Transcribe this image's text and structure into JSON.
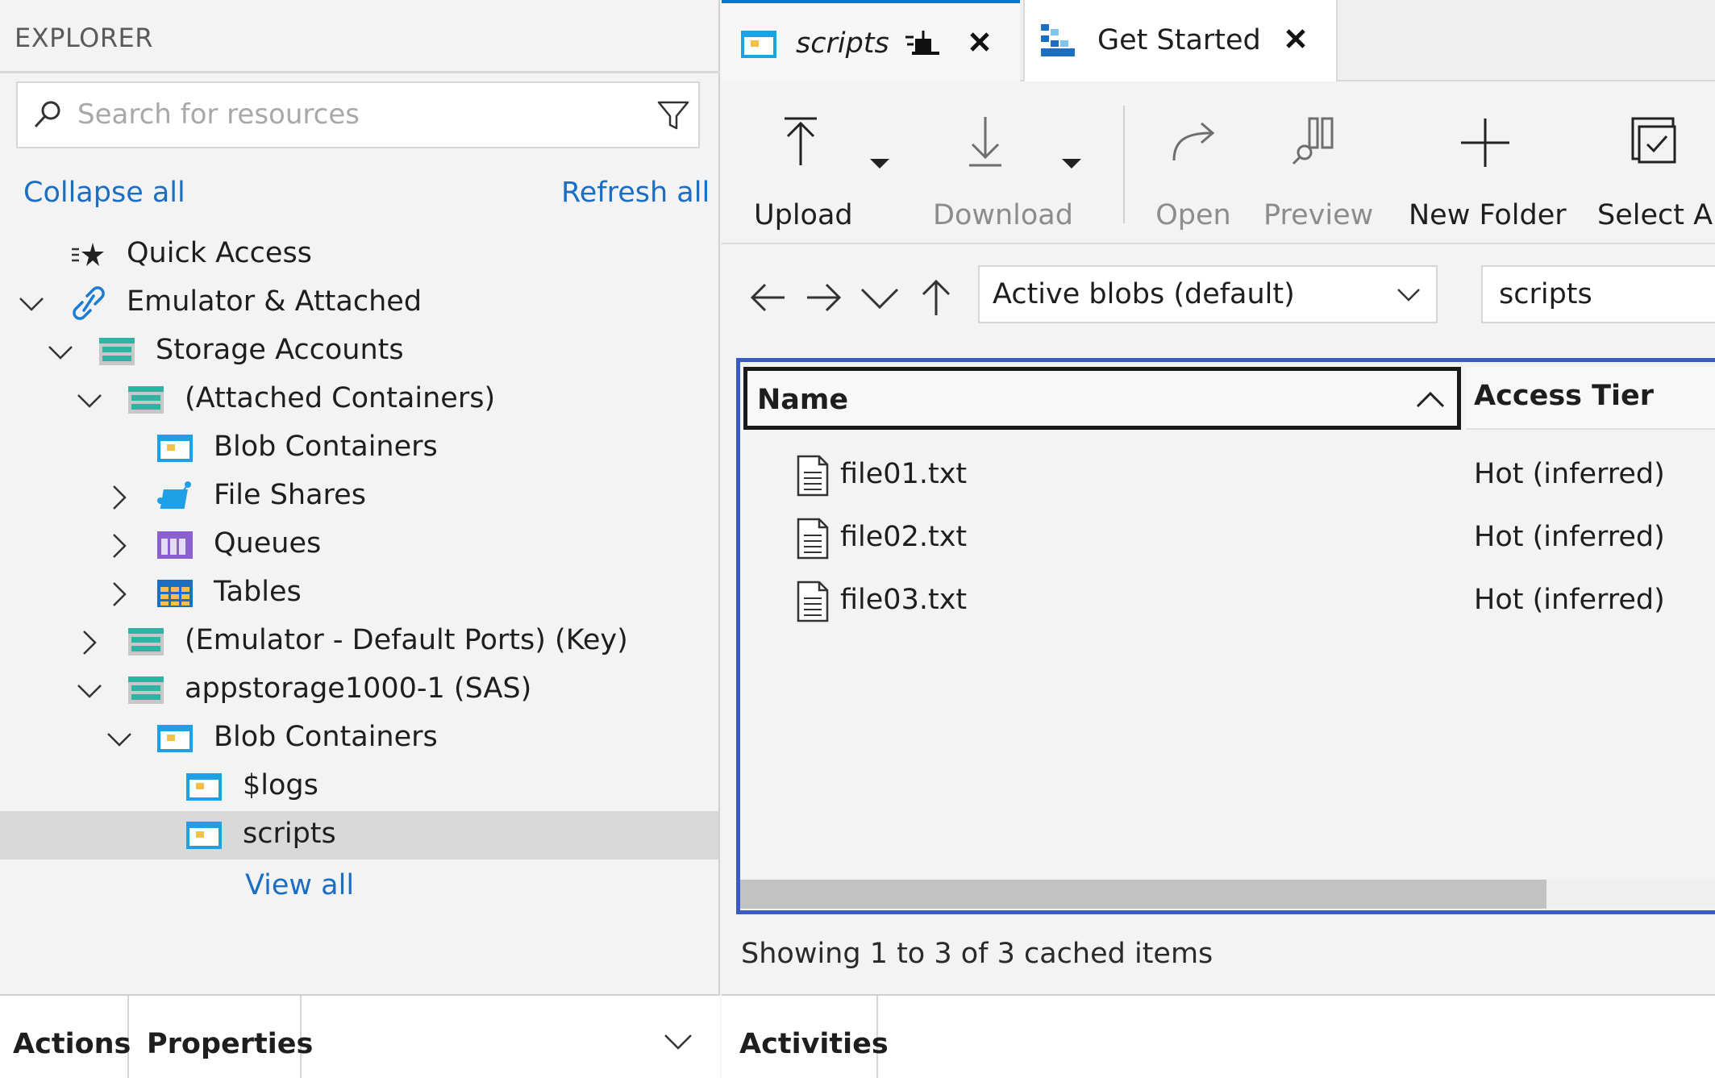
{
  "explorer": {
    "title": "EXPLORER",
    "search_placeholder": "Search for resources",
    "collapse_all": "Collapse all",
    "refresh_all": "Refresh all",
    "view_all": "View all"
  },
  "tree": [
    {
      "label": "Quick Access"
    },
    {
      "label": "Emulator & Attached"
    },
    {
      "label": "Storage Accounts"
    },
    {
      "label": "(Attached Containers)"
    },
    {
      "label": "Blob Containers"
    },
    {
      "label": "File Shares"
    },
    {
      "label": "Queues"
    },
    {
      "label": "Tables"
    },
    {
      "label": "(Emulator - Default Ports) (Key)"
    },
    {
      "label": "appstorage1000-1 (SAS)"
    },
    {
      "label": "Blob Containers"
    },
    {
      "label": "$logs"
    },
    {
      "label": "scripts"
    }
  ],
  "left_bottom_tabs": [
    "Actions",
    "Properties"
  ],
  "tabs": [
    {
      "label": "scripts",
      "active": true
    },
    {
      "label": "Get Started",
      "active": false
    }
  ],
  "toolbar": {
    "upload": "Upload",
    "download": "Download",
    "open": "Open",
    "preview": "Preview",
    "new_folder": "New Folder",
    "select_all": "Select All"
  },
  "nav": {
    "view_mode": "Active blobs (default)",
    "path": "scripts"
  },
  "grid": {
    "columns": [
      "Name",
      "Access Tier"
    ],
    "rows": [
      {
        "name": "file01.txt",
        "tier": "Hot (inferred)"
      },
      {
        "name": "file02.txt",
        "tier": "Hot (inferred)"
      },
      {
        "name": "file03.txt",
        "tier": "Hot (inferred)"
      }
    ]
  },
  "status": "Showing 1 to 3 of 3 cached items",
  "right_bottom_tabs": [
    "Activities"
  ],
  "colors": {
    "accent": "#0078d4",
    "link": "#1b6ec2",
    "grid_focus_border": "#3a5bbf",
    "selected_row": "#d9d9d9"
  }
}
